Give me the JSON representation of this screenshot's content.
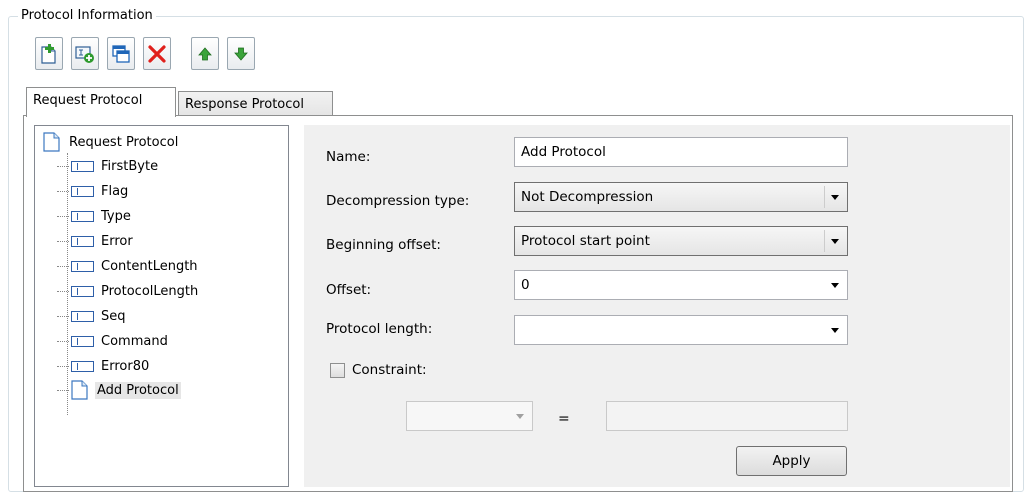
{
  "group": {
    "title": "Protocol Information"
  },
  "toolbar": {
    "buttons": [
      {
        "icon": "add-document-icon"
      },
      {
        "icon": "add-field-icon"
      },
      {
        "icon": "copy-window-icon"
      },
      {
        "icon": "delete-icon"
      },
      {
        "icon": "move-up-icon"
      },
      {
        "icon": "move-down-icon"
      }
    ]
  },
  "tabs": [
    {
      "label": "Request Protocol",
      "active": true
    },
    {
      "label": "Response Protocol",
      "active": false
    }
  ],
  "tree": {
    "root": "Request Protocol",
    "items": [
      {
        "label": "FirstByte",
        "icon": "field-icon"
      },
      {
        "label": "Flag",
        "icon": "field-icon"
      },
      {
        "label": "Type",
        "icon": "field-icon"
      },
      {
        "label": "Error",
        "icon": "field-icon"
      },
      {
        "label": "ContentLength",
        "icon": "field-icon"
      },
      {
        "label": "ProtocolLength",
        "icon": "field-icon"
      },
      {
        "label": "Seq",
        "icon": "field-icon"
      },
      {
        "label": "Command",
        "icon": "field-icon"
      },
      {
        "label": "Error80",
        "icon": "field-icon"
      },
      {
        "label": "Add Protocol",
        "icon": "document-icon",
        "selected": true
      }
    ]
  },
  "form": {
    "name_label": "Name:",
    "name_value": "Add Protocol",
    "decompression_label": "Decompression type:",
    "decompression_value": "Not Decompression",
    "beginning_offset_label": "Beginning offset:",
    "beginning_offset_value": "Protocol start point",
    "offset_label": "Offset:",
    "offset_value": "0",
    "protocol_length_label": "Protocol length:",
    "protocol_length_value": "",
    "constraint_label": "Constraint:",
    "constraint_checked": false,
    "equals": "=",
    "apply_label": "Apply"
  },
  "colors": {
    "group_border": "#d5dfe5",
    "panel_bg": "#f0f0f0",
    "add_green": "#2e9a2e",
    "delete_red": "#e0201c"
  }
}
